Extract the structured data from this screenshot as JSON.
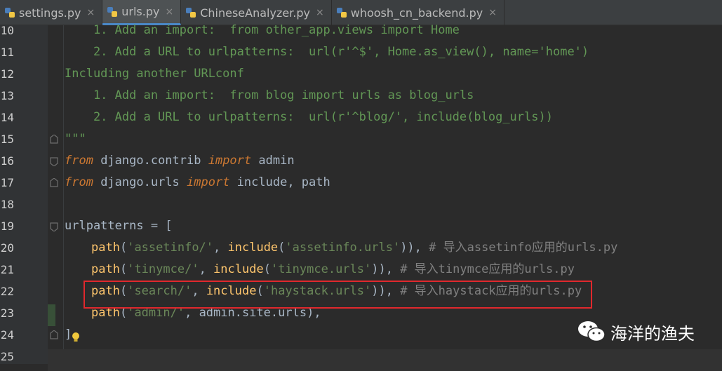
{
  "tabs": [
    {
      "label": "settings.py",
      "active": false
    },
    {
      "label": "urls.py",
      "active": true
    },
    {
      "label": "ChineseAnalyzer.py",
      "active": false
    },
    {
      "label": "whoosh_cn_backend.py",
      "active": false
    }
  ],
  "tab_close_glyph": "×",
  "lines": [
    {
      "num": "10",
      "text": "    1. Add an import:  from other_app.views import Home"
    },
    {
      "num": "11",
      "text": "    2. Add a URL to urlpatterns:  url(r'^$', Home.as_view(), name='home')"
    },
    {
      "num": "12",
      "text": "Including another URLconf"
    },
    {
      "num": "13",
      "text": "    1. Add an import:  from blog import urls as blog_urls"
    },
    {
      "num": "14",
      "text": "    2. Add a URL to urlpatterns:  url(r'^blog/', include(blog_urls))"
    },
    {
      "num": "15",
      "text": "\"\"\""
    },
    {
      "num": "16",
      "kw1": "from",
      "mid": " django.contrib ",
      "kw2": "import",
      "rest": " admin"
    },
    {
      "num": "17",
      "kw1": "from",
      "mid": " django.urls ",
      "kw2": "import",
      "rest": " include, path"
    },
    {
      "num": "18",
      "text": ""
    },
    {
      "num": "19",
      "text": "urlpatterns = ["
    },
    {
      "num": "20",
      "path_fn": "path",
      "arg1": "'assetinfo/'",
      "inc": "include",
      "arg2": "'assetinfo.urls'",
      "close": ")),",
      "comment": " # 导入assetinfo应用的urls.py"
    },
    {
      "num": "21",
      "path_fn": "path",
      "arg1": "'tinymce/'",
      "inc": "include",
      "arg2": "'tinymce.urls'",
      "close": ")),",
      "comment": " # 导入tinymce应用的urls.py"
    },
    {
      "num": "22",
      "path_fn": "path",
      "arg1": "'search/'",
      "inc": "include",
      "arg2": "'haystack.urls'",
      "close": ")),",
      "comment": " # 导入haystack应用的urls.py"
    },
    {
      "num": "23",
      "path_fn": "path",
      "arg1": "'admin/'",
      "tail": ", admin.site.urls),"
    },
    {
      "num": "24",
      "text": "]"
    },
    {
      "num": "25",
      "text": ""
    }
  ],
  "watermark": {
    "text": "海洋的渔夫",
    "icon": "wechat-icon"
  },
  "colors": {
    "highlight_box": "#e0282d",
    "keyword": "#cc7832",
    "string": "#6a8759",
    "docstring": "#629755",
    "comment": "#808080"
  }
}
